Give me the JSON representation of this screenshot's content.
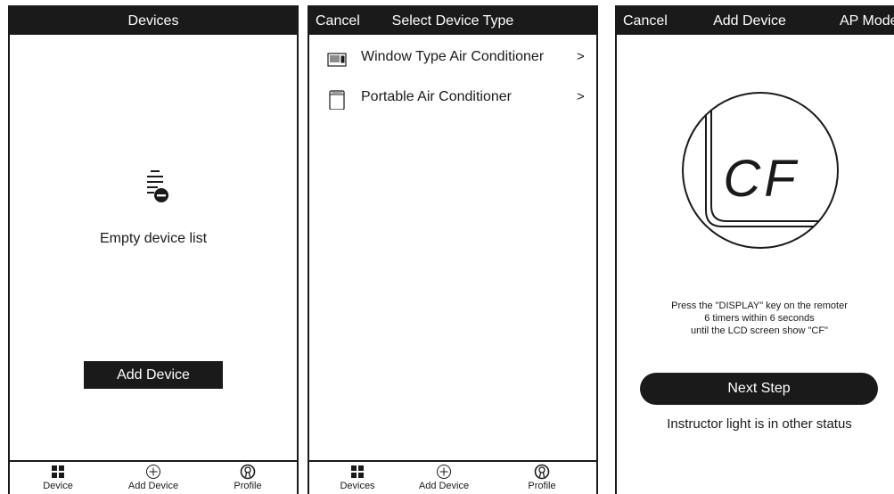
{
  "screen1": {
    "title": "Devices",
    "empty_text": "Empty device list",
    "add_button": "Add Device",
    "tabs": [
      {
        "label": "Device",
        "icon": "grid-icon"
      },
      {
        "label": "Add Device",
        "icon": "plus-circle-icon"
      },
      {
        "label": "Profile",
        "icon": "profile-icon"
      }
    ]
  },
  "screen2": {
    "cancel": "Cancel",
    "title": "Select Device Type",
    "items": [
      {
        "label": "Window Type Air Conditioner",
        "icon": "window-ac-icon",
        "chevron": ">"
      },
      {
        "label": "Portable Air Conditioner",
        "icon": "portable-ac-icon",
        "chevron": ">"
      }
    ],
    "tabs": [
      {
        "label": "Devices",
        "icon": "grid-icon"
      },
      {
        "label": "Add Device",
        "icon": "plus-circle-icon"
      },
      {
        "label": "Profile",
        "icon": "profile-icon"
      }
    ]
  },
  "screen3": {
    "cancel": "Cancel",
    "title": "Add Device",
    "right": "AP Mode",
    "lcd_text": "CF",
    "instructions": [
      "Press the \"DISPLAY\" key on the remoter",
      "6 timers within 6 seconds",
      "until the LCD screen show \"CF\""
    ],
    "next_button": "Next Step",
    "other_status": "Instructor light is in other status"
  },
  "colors": {
    "header_bg": "#1a1a1a",
    "header_text": "#ffffff",
    "background": "#ffffff"
  }
}
